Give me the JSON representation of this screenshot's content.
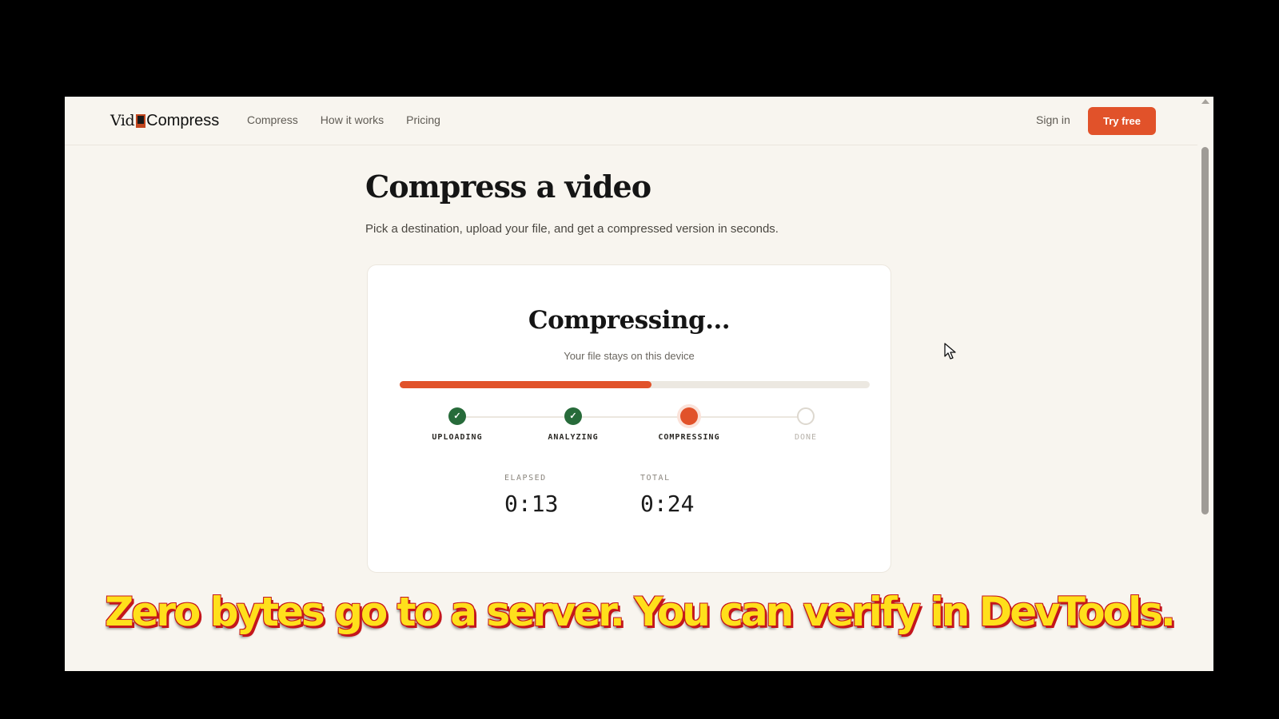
{
  "header": {
    "logo_left": "Vid",
    "logo_right": "Compress",
    "nav": [
      "Compress",
      "How it works",
      "Pricing"
    ],
    "sign_in": "Sign in",
    "cta": "Try free"
  },
  "page": {
    "title": "Compress a video",
    "subtitle": "Pick a destination, upload your file, and get a compressed version in seconds."
  },
  "card": {
    "title": "Compressing...",
    "subtitle": "Your file stays on this device",
    "progress": 0.535,
    "steps": [
      {
        "label": "UPLOADING",
        "state": "done"
      },
      {
        "label": "ANALYZING",
        "state": "done"
      },
      {
        "label": "COMPRESSING",
        "state": "active"
      },
      {
        "label": "DONE",
        "state": "pending"
      }
    ],
    "elapsed_label": "ELAPSED",
    "elapsed_value": "0:13",
    "total_label": "TOTAL",
    "total_value": "0:24"
  },
  "caption": "Zero bytes go to a server. You can verify in DevTools.",
  "colors": {
    "accent": "#e1522a",
    "done": "#276b3a",
    "background": "#f8f5ef",
    "caption": "#ffe01b"
  },
  "icons": {
    "check": "check-icon",
    "cursor": "mouse-cursor-icon"
  }
}
